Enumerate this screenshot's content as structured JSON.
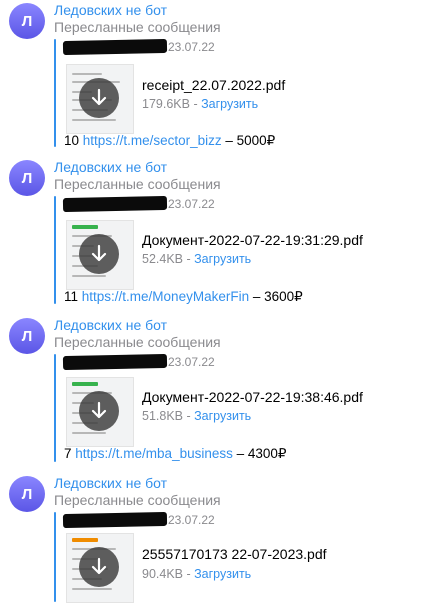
{
  "colors": {
    "accent": "#3390ec",
    "muted": "#8a8a8e",
    "avatar": "#6b66f5"
  },
  "messages": [
    {
      "avatar_letter": "Л",
      "sender": "Ледовских не бот",
      "forwarded_label": "Пересланные сообщения",
      "date": "23.07.22",
      "file_name": "receipt_22.07.2022.pdf",
      "file_size": "179.6KB",
      "download_label": "Загрузить",
      "caption": {
        "prefix": "10",
        "link": "https://t.me/sector_bizz",
        "suffix": "– 5000₽"
      }
    },
    {
      "avatar_letter": "Л",
      "sender": "Ледовских не бот",
      "forwarded_label": "Пересланные сообщения",
      "date": "23.07.22",
      "file_name": "Документ-2022-07-22-19:31:29.pdf",
      "file_size": "52.4KB",
      "download_label": "Загрузить",
      "caption": {
        "prefix": "11",
        "link": "https://t.me/MoneyMakerFin",
        "suffix": "– 3600₽"
      }
    },
    {
      "avatar_letter": "Л",
      "sender": "Ледовских не бот",
      "forwarded_label": "Пересланные сообщения",
      "date": "23.07.22",
      "file_name": "Документ-2022-07-22-19:38:46.pdf",
      "file_size": "51.8KB",
      "download_label": "Загрузить",
      "caption": {
        "prefix": "7",
        "link": "https://t.me/mba_business",
        "suffix": "– 4300₽"
      }
    },
    {
      "avatar_letter": "Л",
      "sender": "Ледовских не бот",
      "forwarded_label": "Пересланные сообщения",
      "date": "23.07.22",
      "file_name": "25557170173 22-07-2023.pdf",
      "file_size": "90.4KB",
      "download_label": "Загрузить"
    }
  ]
}
